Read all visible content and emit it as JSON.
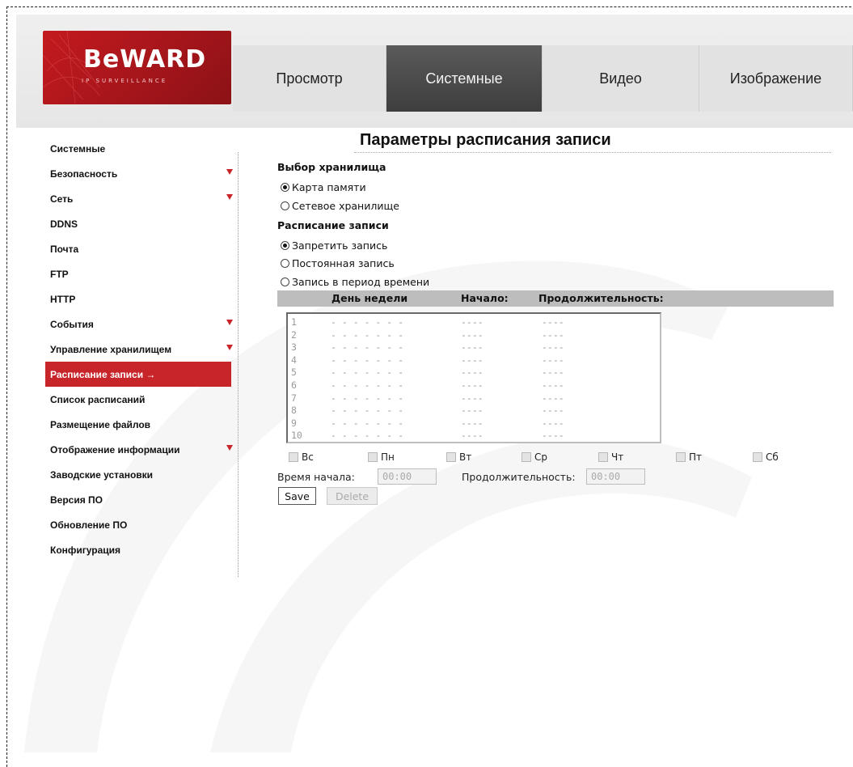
{
  "header": {
    "logo_text": "BeWARD",
    "logo_sub": "IP SURVEILLANCE",
    "tabs": [
      {
        "label": "Просмотр",
        "active": false
      },
      {
        "label": "Системные",
        "active": true
      },
      {
        "label": "Видео",
        "active": false
      },
      {
        "label": "Изображение",
        "active": false
      }
    ]
  },
  "sidebar": {
    "items": [
      {
        "label": "Системные"
      },
      {
        "label": "Безопасность",
        "expand": true
      },
      {
        "label": "Сеть",
        "expand": true
      },
      {
        "label": "DDNS"
      },
      {
        "label": "Почта"
      },
      {
        "label": "FTP"
      },
      {
        "label": "HTTP"
      },
      {
        "label": "События",
        "expand": true
      },
      {
        "label": "Управление хранилищем",
        "expand": true
      },
      {
        "label": "Расписание записи →",
        "active": true
      },
      {
        "label": "Список расписаний"
      },
      {
        "label": "Размещение файлов"
      },
      {
        "label": "Отображение информации",
        "expand": true
      },
      {
        "label": "Заводские установки"
      },
      {
        "label": "Версия ПО"
      },
      {
        "label": "Обновление ПО"
      },
      {
        "label": "Конфигурация"
      }
    ]
  },
  "main": {
    "title": "Параметры расписания записи",
    "storage": {
      "label": "Выбор хранилища",
      "options": [
        {
          "label": "Карта памяти",
          "checked": true
        },
        {
          "label": "Сетевое хранилище",
          "checked": false
        }
      ]
    },
    "schedule": {
      "label": "Расписание записи",
      "options": [
        {
          "label": "Запретить запись",
          "checked": true
        },
        {
          "label": "Постоянная запись",
          "checked": false
        },
        {
          "label": "Запись в период времени",
          "checked": false
        }
      ]
    },
    "table": {
      "headers": {
        "day": "День недели",
        "start": "Начало:",
        "duration": "Продолжительность:"
      },
      "rows": [
        {
          "n": "1",
          "days": "- - - - - - -",
          "start": "----",
          "duration": "----"
        },
        {
          "n": "2",
          "days": "- - - - - - -",
          "start": "----",
          "duration": "----"
        },
        {
          "n": "3",
          "days": "- - - - - - -",
          "start": "----",
          "duration": "----"
        },
        {
          "n": "4",
          "days": "- - - - - - -",
          "start": "----",
          "duration": "----"
        },
        {
          "n": "5",
          "days": "- - - - - - -",
          "start": "----",
          "duration": "----"
        },
        {
          "n": "6",
          "days": "- - - - - - -",
          "start": "----",
          "duration": "----"
        },
        {
          "n": "7",
          "days": "- - - - - - -",
          "start": "----",
          "duration": "----"
        },
        {
          "n": "8",
          "days": "- - - - - - -",
          "start": "----",
          "duration": "----"
        },
        {
          "n": "9",
          "days": "- - - - - - -",
          "start": "----",
          "duration": "----"
        },
        {
          "n": "10",
          "days": "- - - - - - -",
          "start": "----",
          "duration": "----"
        }
      ]
    },
    "days": [
      "Вс",
      "Пн",
      "Вт",
      "Ср",
      "Чт",
      "Пт",
      "Сб"
    ],
    "start_time": {
      "label": "Время начала:",
      "value": "00:00"
    },
    "duration": {
      "label": "Продолжительность:",
      "value": "00:00"
    },
    "save_label": "Save",
    "delete_label": "Delete"
  },
  "colors": {
    "accent": "#c8252b",
    "active_tab": "#4a4a4a",
    "table_header": "#bdbdbd"
  }
}
